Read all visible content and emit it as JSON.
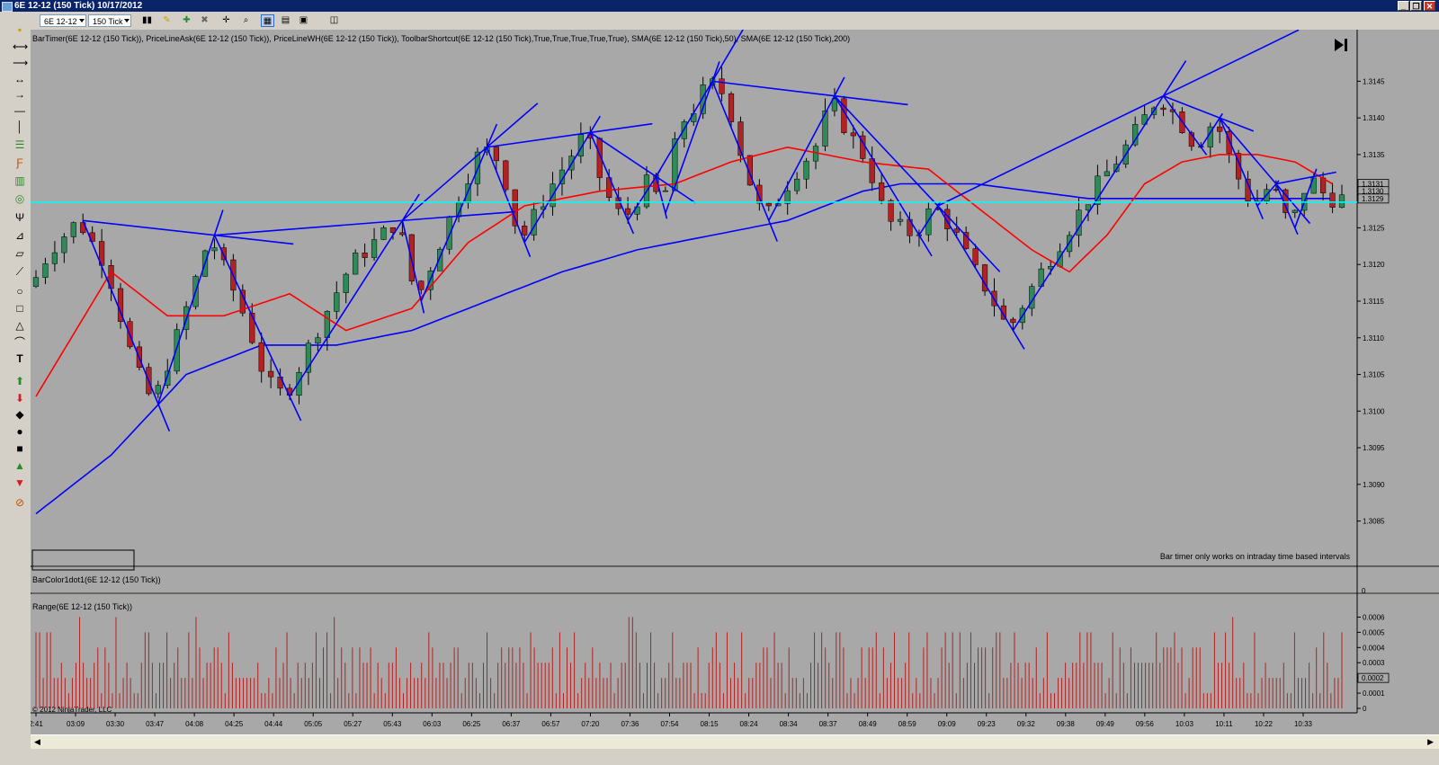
{
  "window": {
    "title": "6E 12-12 (150 Tick)  10/17/2012",
    "buttons": [
      "_",
      "❐",
      "✕"
    ]
  },
  "toolbar": {
    "instrument": "6E 12-12",
    "interval": "150 Tick"
  },
  "price_panel": {
    "indicator_label": "BarTimer(6E 12-12 (150 Tick)), PriceLineAsk(6E 12-12 (150 Tick)), PriceLineWH(6E 12-12 (150 Tick)), ToolbarShortcut(6E 12-12 (150 Tick),True,True,True,True,True), SMA(6E 12-12 (150 Tick),50), SMA(6E 12-12 (150 Tick),200)",
    "bar_timer_note": "Bar timer only works on intraday time based intervals",
    "last_price_labels": [
      "1.3131",
      "1.3130",
      "1.3129"
    ],
    "colors": {
      "background": "#a8a8a8",
      "sma50": "#ff0000",
      "sma200": "#0000ff",
      "priceline": "#00ffff",
      "trendline": "#0000ff",
      "up_bar": "#2e8b57",
      "down_bar": "#b22222"
    }
  },
  "barcolor_panel": {
    "label": "BarColor1dot1(6E 12-12 (150 Tick))",
    "zero_label": "0"
  },
  "range_panel": {
    "label": "Range(6E 12-12 (150 Tick))",
    "last_value": "0.0002",
    "copyright": "© 2012 NinjaTrader, LLC"
  },
  "chart_data": [
    {
      "type": "candlestick",
      "title": "6E 12-12 (150 Tick)",
      "y_ticks": [
        "1.3145",
        "1.3140",
        "1.3135",
        "1.3130",
        "1.3125",
        "1.3120",
        "1.3115",
        "1.3110",
        "1.3105",
        "1.3100",
        "1.3095",
        "1.3090",
        "1.3085"
      ],
      "ylim": [
        1.30825,
        1.31475
      ],
      "x_ticks": [
        "2:41",
        "03:09",
        "03:30",
        "03:47",
        "04:08",
        "04:25",
        "04:44",
        "05:05",
        "05:27",
        "05:43",
        "06:03",
        "06:25",
        "06:37",
        "06:57",
        "07:20",
        "07:36",
        "07:54",
        "08:15",
        "08:24",
        "08:34",
        "08:37",
        "08:49",
        "08:59",
        "09:09",
        "09:23",
        "09:32",
        "09:38",
        "09:49",
        "09:56",
        "10:03",
        "10:11",
        "10:22",
        "10:33"
      ],
      "price_path": [
        [
          0,
          1.3117
        ],
        [
          2,
          1.3122
        ],
        [
          5,
          1.3126
        ],
        [
          8,
          1.312
        ],
        [
          11,
          1.3106
        ],
        [
          13,
          1.3101
        ],
        [
          16,
          1.3112
        ],
        [
          19,
          1.3124
        ],
        [
          23,
          1.3112
        ],
        [
          25,
          1.3104
        ],
        [
          27,
          1.3102
        ],
        [
          30,
          1.311
        ],
        [
          34,
          1.312
        ],
        [
          39,
          1.3126
        ],
        [
          41,
          1.3115
        ],
        [
          46,
          1.3131
        ],
        [
          48,
          1.3136
        ],
        [
          50,
          1.3134
        ],
        [
          52,
          1.3123
        ],
        [
          55,
          1.313
        ],
        [
          58,
          1.3136
        ],
        [
          59,
          1.3138
        ],
        [
          61,
          1.313
        ],
        [
          63,
          1.3126
        ],
        [
          66,
          1.3132
        ],
        [
          67,
          1.3127
        ],
        [
          69,
          1.3139
        ],
        [
          71,
          1.3142
        ],
        [
          72,
          1.3145
        ],
        [
          74,
          1.3143
        ],
        [
          76,
          1.3133
        ],
        [
          78,
          1.3126
        ],
        [
          81,
          1.3132
        ],
        [
          84,
          1.3137
        ],
        [
          85,
          1.3143
        ],
        [
          86,
          1.314
        ],
        [
          89,
          1.3134
        ],
        [
          91,
          1.3126
        ],
        [
          94,
          1.3124
        ],
        [
          96,
          1.3128
        ],
        [
          98,
          1.3125
        ],
        [
          100,
          1.312
        ],
        [
          102,
          1.3116
        ],
        [
          104,
          1.3111
        ],
        [
          107,
          1.3118
        ],
        [
          110,
          1.3124
        ],
        [
          113,
          1.313
        ],
        [
          116,
          1.3135
        ],
        [
          118,
          1.3139
        ],
        [
          120,
          1.3143
        ],
        [
          122,
          1.314
        ],
        [
          124,
          1.3136
        ],
        [
          126,
          1.314
        ],
        [
          128,
          1.3133
        ],
        [
          130,
          1.3128
        ],
        [
          132,
          1.3131
        ],
        [
          134,
          1.3125
        ],
        [
          136,
          1.3132
        ],
        [
          138,
          1.3129
        ]
      ],
      "bar_count": 140,
      "sma50_path": [
        [
          0,
          1.3102
        ],
        [
          8,
          1.3119
        ],
        [
          14,
          1.3113
        ],
        [
          20,
          1.3113
        ],
        [
          27,
          1.3116
        ],
        [
          33,
          1.3111
        ],
        [
          40,
          1.3114
        ],
        [
          46,
          1.3123
        ],
        [
          52,
          1.3128
        ],
        [
          60,
          1.313
        ],
        [
          68,
          1.3131
        ],
        [
          74,
          1.3134
        ],
        [
          80,
          1.3136
        ],
        [
          88,
          1.3134
        ],
        [
          95,
          1.3133
        ],
        [
          101,
          1.3127
        ],
        [
          106,
          1.3122
        ],
        [
          110,
          1.3119
        ],
        [
          114,
          1.3124
        ],
        [
          118,
          1.3131
        ],
        [
          122,
          1.3134
        ],
        [
          126,
          1.3135
        ],
        [
          130,
          1.3135
        ],
        [
          134,
          1.3134
        ],
        [
          138,
          1.3131
        ]
      ],
      "sma200_path": [
        [
          0,
          1.3086
        ],
        [
          8,
          1.3094
        ],
        [
          16,
          1.3105
        ],
        [
          24,
          1.3109
        ],
        [
          32,
          1.3109
        ],
        [
          40,
          1.3111
        ],
        [
          48,
          1.3115
        ],
        [
          56,
          1.3119
        ],
        [
          64,
          1.3122
        ],
        [
          72,
          1.3124
        ],
        [
          80,
          1.3126
        ],
        [
          84,
          1.3128
        ],
        [
          88,
          1.313
        ],
        [
          92,
          1.3131
        ],
        [
          96,
          1.3131
        ],
        [
          100,
          1.3131
        ],
        [
          106,
          1.313
        ],
        [
          112,
          1.3129
        ],
        [
          118,
          1.3129
        ],
        [
          124,
          1.3129
        ],
        [
          130,
          1.3129
        ],
        [
          138,
          1.3129
        ]
      ],
      "priceline": 1.31285
    },
    {
      "type": "bar",
      "title": "Range(6E 12-12 (150 Tick))",
      "y_ticks": [
        "0.0006",
        "0.0005",
        "0.0004",
        "0.0003",
        "0.0002",
        "0.0001",
        "0"
      ],
      "ylim": [
        0,
        0.00065
      ],
      "bar_count": 360
    }
  ]
}
